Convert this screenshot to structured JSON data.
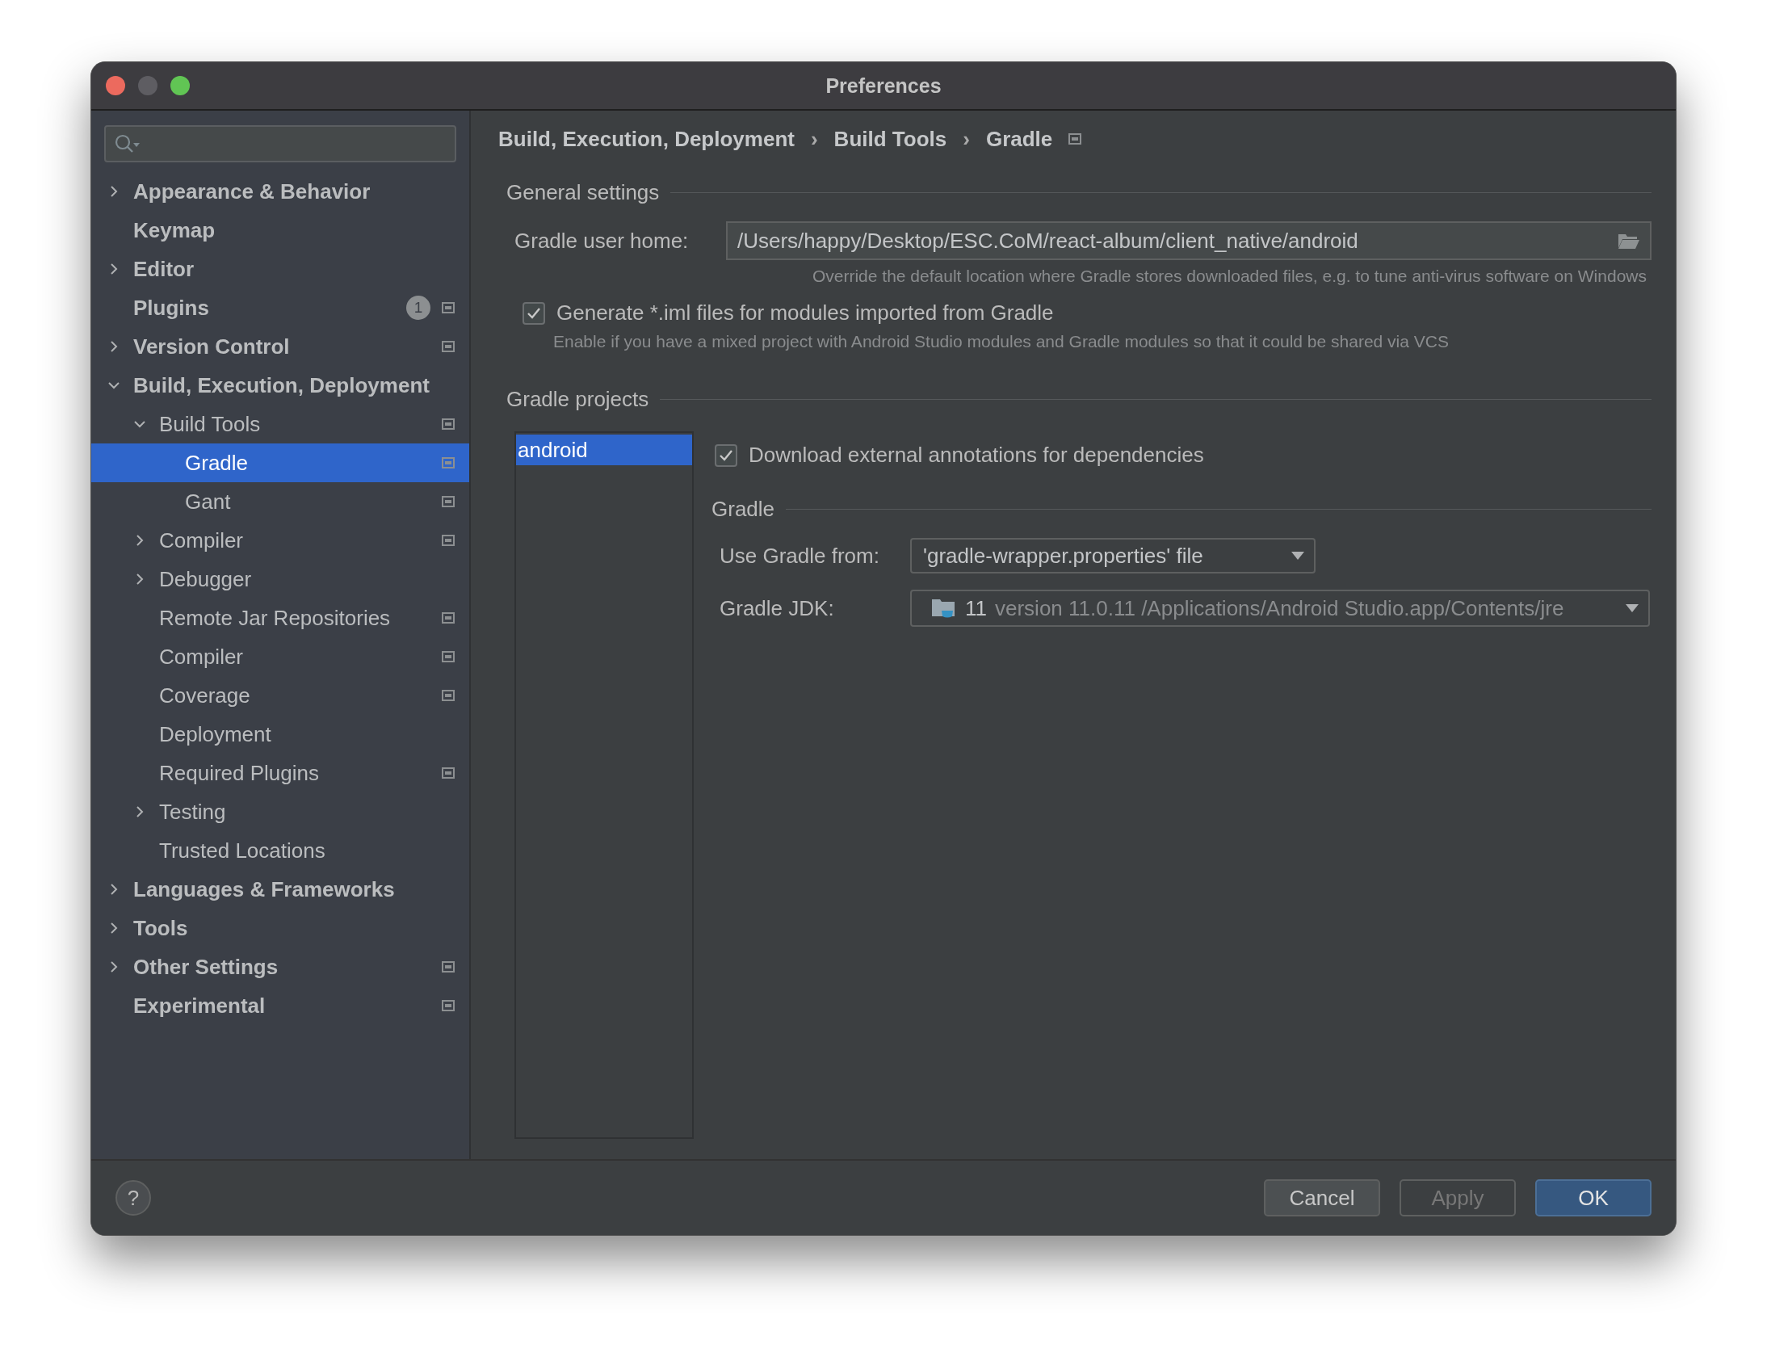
{
  "window": {
    "title": "Preferences"
  },
  "sidebar": {
    "items": [
      {
        "label": "Appearance & Behavior",
        "bold": true,
        "expanded": false,
        "scoped": false,
        "selected": false
      },
      {
        "label": "Keymap",
        "bold": true,
        "scoped": false,
        "selected": false
      },
      {
        "label": "Editor",
        "bold": true,
        "expanded": false,
        "scoped": false,
        "selected": false
      },
      {
        "label": "Plugins",
        "bold": true,
        "badge": "1",
        "scoped": true,
        "selected": false
      },
      {
        "label": "Version Control",
        "bold": true,
        "expanded": false,
        "scoped": true,
        "selected": false
      },
      {
        "label": "Build, Execution, Deployment",
        "bold": true,
        "expanded": true,
        "scoped": false,
        "selected": false,
        "children": [
          {
            "label": "Build Tools",
            "bold": false,
            "expanded": true,
            "scoped": true,
            "selected": false,
            "children": [
              {
                "label": "Gradle",
                "bold": false,
                "scoped": true,
                "selected": true
              },
              {
                "label": "Gant",
                "bold": false,
                "scoped": true,
                "selected": false
              }
            ]
          },
          {
            "label": "Compiler",
            "bold": false,
            "expanded": false,
            "scoped": true,
            "selected": false
          },
          {
            "label": "Debugger",
            "bold": false,
            "expanded": false,
            "scoped": false,
            "selected": false
          },
          {
            "label": "Remote Jar Repositories",
            "bold": false,
            "scoped": true,
            "selected": false
          },
          {
            "label": "Compiler",
            "bold": false,
            "scoped": true,
            "selected": false
          },
          {
            "label": "Coverage",
            "bold": false,
            "scoped": true,
            "selected": false
          },
          {
            "label": "Deployment",
            "bold": false,
            "scoped": false,
            "selected": false
          },
          {
            "label": "Required Plugins",
            "bold": false,
            "scoped": true,
            "selected": false
          },
          {
            "label": "Testing",
            "bold": false,
            "expanded": false,
            "scoped": false,
            "selected": false
          },
          {
            "label": "Trusted Locations",
            "bold": false,
            "scoped": false,
            "selected": false
          }
        ]
      },
      {
        "label": "Languages & Frameworks",
        "bold": true,
        "expanded": false,
        "scoped": false,
        "selected": false
      },
      {
        "label": "Tools",
        "bold": true,
        "expanded": false,
        "scoped": false,
        "selected": false
      },
      {
        "label": "Other Settings",
        "bold": true,
        "expanded": false,
        "scoped": true,
        "selected": false
      },
      {
        "label": "Experimental",
        "bold": true,
        "scoped": true,
        "selected": false
      }
    ]
  },
  "breadcrumb": {
    "items": [
      "Build, Execution, Deployment",
      "Build Tools",
      "Gradle"
    ],
    "separator": "›",
    "scoped": true
  },
  "general_settings": {
    "title": "General settings",
    "user_home_label": "Gradle user home:",
    "user_home_value": "/Users/happy/Desktop/ESC.CoM/react-album/client_native/android",
    "user_home_hint": "Override the default location where Gradle stores downloaded files, e.g. to tune anti-virus software on Windows",
    "generate_iml": {
      "label": "Generate *.iml files for modules imported from Gradle",
      "checked": true,
      "description": "Enable if you have a mixed project with Android Studio modules and Gradle modules so that it could be shared via VCS"
    }
  },
  "gradle_projects": {
    "title": "Gradle projects",
    "projects": [
      {
        "name": "android",
        "selected": true
      }
    ],
    "download_annotations": {
      "label": "Download external annotations for dependencies",
      "checked": true
    },
    "gradle": {
      "title": "Gradle",
      "use_from_label": "Use Gradle from:",
      "use_from_value": "'gradle-wrapper.properties' file",
      "jdk_label": "Gradle JDK:",
      "jdk_name": "11",
      "jdk_detail": "version 11.0.11 /Applications/Android Studio.app/Contents/jre"
    }
  },
  "footer": {
    "help": "?",
    "buttons": [
      {
        "label": "Cancel",
        "kind": "normal",
        "disabled": false
      },
      {
        "label": "Apply",
        "kind": "normal",
        "disabled": true
      },
      {
        "label": "OK",
        "kind": "default",
        "disabled": false
      }
    ]
  }
}
